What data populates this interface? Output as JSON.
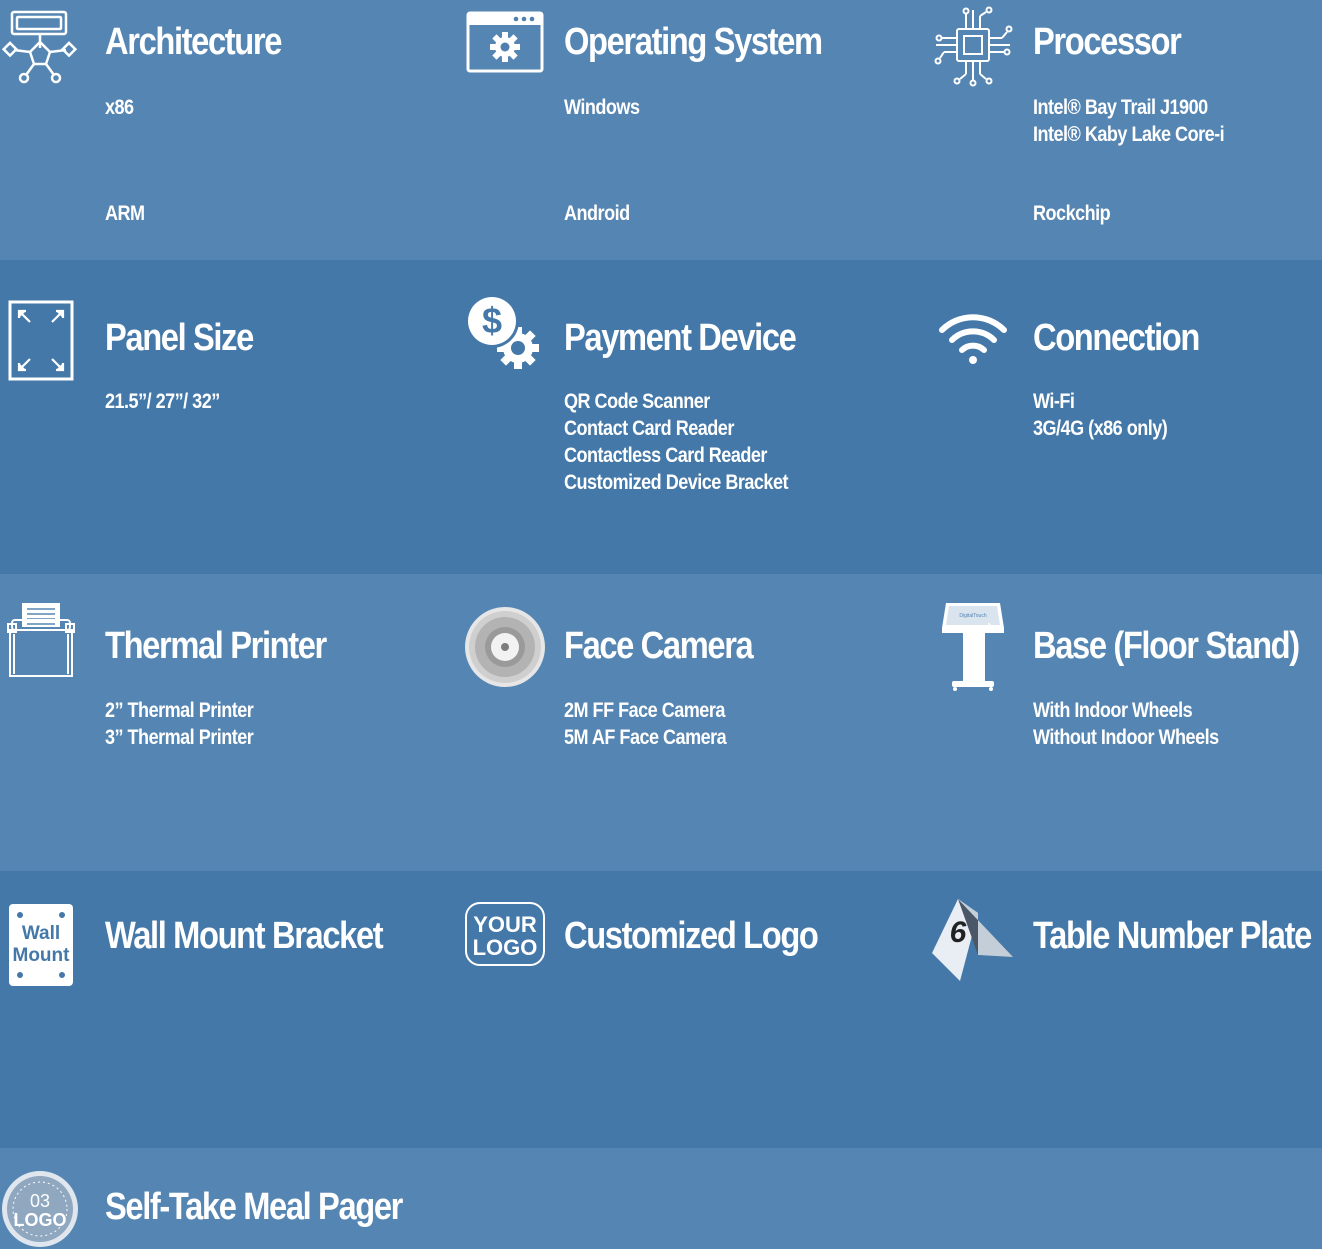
{
  "rows": [
    {
      "items": [
        {
          "icon": "architecture-icon",
          "title": "Architecture",
          "lines": [
            "x86"
          ],
          "lines2": [
            "ARM"
          ]
        },
        {
          "icon": "operating-system-icon",
          "title": "Operating System",
          "lines": [
            "Windows"
          ],
          "lines2": [
            "Android"
          ]
        },
        {
          "icon": "processor-chip-icon",
          "title": "Processor",
          "lines": [
            "Intel® Bay Trail J1900",
            "Intel® Kaby Lake Core-i"
          ],
          "lines2": [
            "Rockchip"
          ]
        }
      ]
    },
    {
      "items": [
        {
          "icon": "panel-size-icon",
          "title": "Panel Size",
          "lines": [
            "21.5”/ 27”/ 32”"
          ]
        },
        {
          "icon": "payment-device-icon",
          "title": "Payment Device",
          "lines": [
            "QR Code Scanner",
            "Contact Card Reader",
            "Contactless Card Reader",
            "Customized Device Bracket"
          ]
        },
        {
          "icon": "wifi-icon",
          "title": "Connection",
          "lines": [
            "Wi-Fi",
            "3G/4G (x86 only)"
          ]
        }
      ]
    },
    {
      "items": [
        {
          "icon": "thermal-printer-icon",
          "title": "Thermal Printer",
          "lines": [
            "2” Thermal Printer",
            "3” Thermal Printer"
          ]
        },
        {
          "icon": "face-camera-icon",
          "title": "Face Camera",
          "lines": [
            "2M FF Face Camera",
            "5M AF Face Camera"
          ]
        },
        {
          "icon": "floor-stand-icon",
          "title": "Base (Floor Stand)",
          "lines": [
            "With Indoor Wheels",
            "Without Indoor Wheels"
          ]
        }
      ]
    },
    {
      "items": [
        {
          "icon": "wall-mount-icon",
          "title": "Wall Mount Bracket",
          "lines": [],
          "icon_text": [
            "Wall",
            "Mount"
          ]
        },
        {
          "icon": "custom-logo-icon",
          "title": "Customized Logo",
          "lines": [],
          "icon_text": [
            "YOUR",
            "LOGO"
          ]
        },
        {
          "icon": "table-number-plate-icon",
          "title": "Table Number Plate",
          "lines": [],
          "icon_text": [
            "6"
          ]
        }
      ]
    },
    {
      "items": [
        {
          "icon": "meal-pager-icon",
          "title": "Self-Take Meal Pager",
          "lines": [],
          "icon_text": [
            "03",
            "LOGO"
          ]
        }
      ]
    }
  ],
  "colors": {
    "band_light": "#5585b2",
    "band_dark": "#4478a8",
    "text": "#ffffff"
  }
}
